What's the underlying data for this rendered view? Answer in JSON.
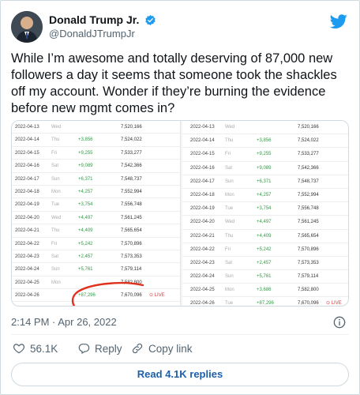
{
  "author": {
    "display_name": "Donald Trump Jr.",
    "handle": "@DonaldJTrumpJr"
  },
  "tweet": {
    "text": "While I’m awesome and totally deserving of 87,000 new followers a day it seems that someone took the shackles off my account. Wonder if they’re burning the evidence before new mgmt comes in?",
    "timestamp": "2:14 PM · Apr 26, 2022"
  },
  "media": {
    "left_table": [
      {
        "date": "2022-04-13",
        "day": "Wed",
        "delta": "",
        "total": "7,520,166",
        "live": ""
      },
      {
        "date": "2022-04-14",
        "day": "Thu",
        "delta": "+3,856",
        "total": "7,524,022",
        "live": ""
      },
      {
        "date": "2022-04-15",
        "day": "Fri",
        "delta": "+9,255",
        "total": "7,533,277",
        "live": ""
      },
      {
        "date": "2022-04-16",
        "day": "Sat",
        "delta": "+9,089",
        "total": "7,542,366",
        "live": ""
      },
      {
        "date": "2022-04-17",
        "day": "Sun",
        "delta": "+6,371",
        "total": "7,548,737",
        "live": ""
      },
      {
        "date": "2022-04-18",
        "day": "Mon",
        "delta": "+4,257",
        "total": "7,552,994",
        "live": ""
      },
      {
        "date": "2022-04-19",
        "day": "Tue",
        "delta": "+3,754",
        "total": "7,556,748",
        "live": ""
      },
      {
        "date": "2022-04-20",
        "day": "Wed",
        "delta": "+4,497",
        "total": "7,561,245",
        "live": ""
      },
      {
        "date": "2022-04-21",
        "day": "Thu",
        "delta": "+4,409",
        "total": "7,565,654",
        "live": ""
      },
      {
        "date": "2022-04-22",
        "day": "Fri",
        "delta": "+5,242",
        "total": "7,570,896",
        "live": ""
      },
      {
        "date": "2022-04-23",
        "day": "Sat",
        "delta": "+2,457",
        "total": "7,573,353",
        "live": ""
      },
      {
        "date": "2022-04-24",
        "day": "Sun",
        "delta": "+5,761",
        "total": "7,579,114",
        "live": ""
      },
      {
        "date": "2022-04-25",
        "day": "Mon",
        "delta": "",
        "total": "7,582,800",
        "live": ""
      },
      {
        "date": "2022-04-26",
        "day": "",
        "delta": "+87,296",
        "total": "7,670,096",
        "live": "⊙ LIVE"
      }
    ],
    "right_table": [
      {
        "date": "2022-04-13",
        "day": "Wed",
        "delta": "",
        "total": "7,520,166",
        "live": ""
      },
      {
        "date": "2022-04-14",
        "day": "Thu",
        "delta": "+3,856",
        "total": "7,524,022",
        "live": ""
      },
      {
        "date": "2022-04-15",
        "day": "Fri",
        "delta": "+9,255",
        "total": "7,533,277",
        "live": ""
      },
      {
        "date": "2022-04-16",
        "day": "Sat",
        "delta": "+9,089",
        "total": "7,542,366",
        "live": ""
      },
      {
        "date": "2022-04-17",
        "day": "Sun",
        "delta": "+6,371",
        "total": "7,548,737",
        "live": ""
      },
      {
        "date": "2022-04-18",
        "day": "Mon",
        "delta": "+4,257",
        "total": "7,552,994",
        "live": ""
      },
      {
        "date": "2022-04-19",
        "day": "Tue",
        "delta": "+3,754",
        "total": "7,556,748",
        "live": ""
      },
      {
        "date": "2022-04-20",
        "day": "Wed",
        "delta": "+4,497",
        "total": "7,561,245",
        "live": ""
      },
      {
        "date": "2022-04-21",
        "day": "Thu",
        "delta": "+4,409",
        "total": "7,565,654",
        "live": ""
      },
      {
        "date": "2022-04-22",
        "day": "Fri",
        "delta": "+5,242",
        "total": "7,570,896",
        "live": ""
      },
      {
        "date": "2022-04-23",
        "day": "Sat",
        "delta": "+2,457",
        "total": "7,573,353",
        "live": ""
      },
      {
        "date": "2022-04-24",
        "day": "Sun",
        "delta": "+5,761",
        "total": "7,579,114",
        "live": ""
      },
      {
        "date": "2022-04-25",
        "day": "Mon",
        "delta": "+3,686",
        "total": "7,582,800",
        "live": ""
      },
      {
        "date": "2022-04-26",
        "day": "Tue",
        "delta": "+87,296",
        "total": "7,670,096",
        "live": "⊙ LIVE"
      }
    ]
  },
  "actions": {
    "likes": "56.1K",
    "reply_label": "Reply",
    "copy_link_label": "Copy link"
  },
  "replies_button": "Read 4.1K replies",
  "icons": {
    "verified": "verified-badge-icon",
    "logo": "twitter-bird-icon",
    "info": "info-icon",
    "like": "heart-icon",
    "reply": "reply-bubble-icon",
    "copy_link": "link-icon"
  },
  "colors": {
    "brand": "#1d9bf0",
    "delta_green": "#2e9e44",
    "live_red": "#dd3333",
    "annotation_red": "#e0311c"
  }
}
